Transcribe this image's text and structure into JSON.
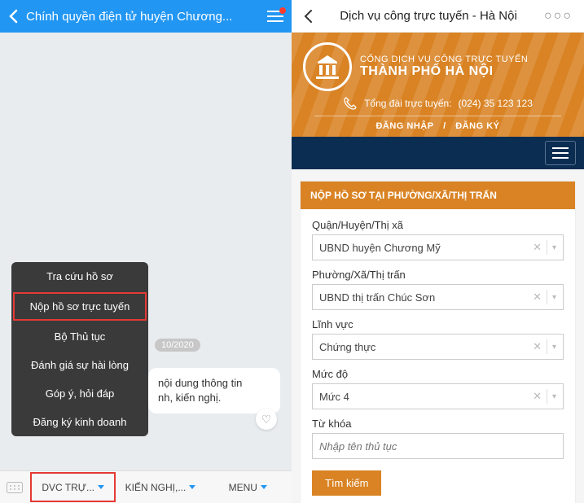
{
  "left": {
    "header_title": "Chính quyền điện tử huyện Chương...",
    "popup": {
      "items": [
        {
          "label": "Tra cứu hồ sơ",
          "highlighted": false
        },
        {
          "label": "Nộp hồ sơ trực tuyến",
          "highlighted": true
        },
        {
          "label": "Bộ Thủ tục",
          "highlighted": false
        },
        {
          "label": "Đánh giá sự hài lòng",
          "highlighted": false
        },
        {
          "label": "Góp ý, hỏi đáp",
          "highlighted": false
        },
        {
          "label": "Đăng ký kinh doanh",
          "highlighted": false
        }
      ]
    },
    "date_chip": "10/2020",
    "msg_line1": "nội dung thông tin",
    "msg_line2": "nh, kiến nghị.",
    "tabs": [
      {
        "label": "DVC TRỰ...",
        "highlighted": true
      },
      {
        "label": "KIẾN NGHỊ,...",
        "highlighted": false
      },
      {
        "label": "MENU",
        "highlighted": false
      }
    ]
  },
  "right": {
    "header_title": "Dịch vụ công trực tuyến - Hà Nội",
    "banner": {
      "t1": "CỔNG DỊCH VỤ CÔNG TRỰC TUYẾN",
      "t2": "THÀNH PHỐ HÀ NỘI",
      "hotline_label": "Tổng đài trực tuyến:",
      "hotline_number": "(024) 35 123 123",
      "link_login": "ĐĂNG NHẬP",
      "link_register": "ĐĂNG KÝ"
    },
    "form": {
      "card_title": "NỘP HỒ SƠ TẠI PHƯỜNG/XÃ/THỊ TRẤN",
      "district_label": "Quận/Huyện/Thị xã",
      "district_value": "UBND huyện Chương Mỹ",
      "ward_label": "Phường/Xã/Thị trấn",
      "ward_value": "UBND thị trấn Chúc Sơn",
      "field_label": "Lĩnh vực",
      "field_value": "Chứng thực",
      "level_label": "Mức độ",
      "level_value": "Mức 4",
      "keyword_label": "Từ khóa",
      "keyword_placeholder": "Nhập tên thủ tục",
      "search_btn": "Tìm kiếm"
    }
  }
}
